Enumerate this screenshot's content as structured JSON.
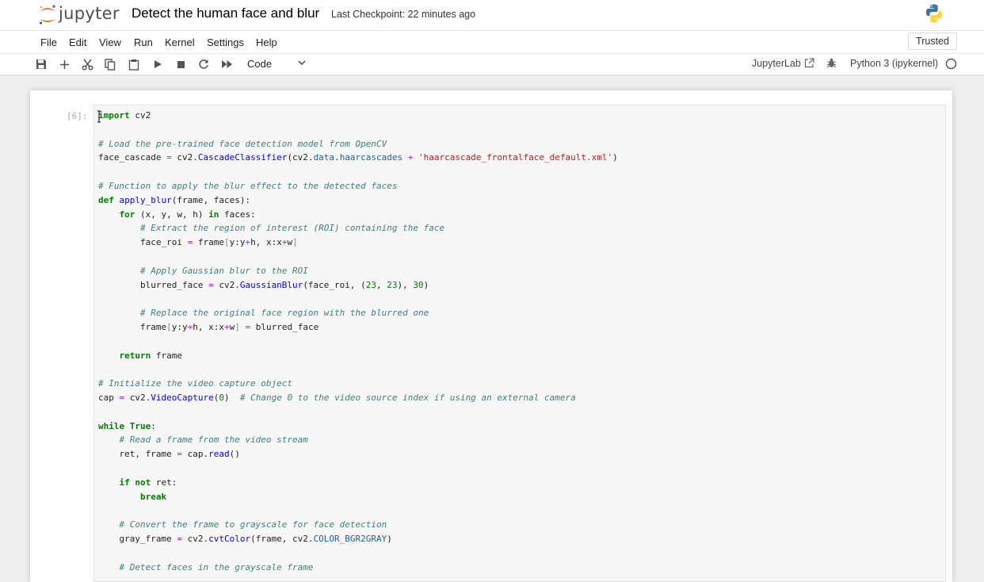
{
  "header": {
    "logo_text": "jupyter",
    "notebook_title": "Detect the human face and blur",
    "checkpoint": "Last Checkpoint: 22 minutes ago"
  },
  "menu": {
    "items": [
      "File",
      "Edit",
      "View",
      "Run",
      "Kernel",
      "Settings",
      "Help"
    ],
    "trusted_label": "Trusted"
  },
  "toolbar": {
    "icons": [
      "save-icon",
      "add-cell-icon",
      "cut-icon",
      "copy-icon",
      "paste-icon",
      "run-icon",
      "stop-icon",
      "restart-icon",
      "fast-forward-icon"
    ],
    "cell_type": "Code",
    "jupyterlab_label": "JupyterLab",
    "kernel_name": "Python 3 (ipykernel)"
  },
  "cell": {
    "prompt": "[6]:",
    "lines": [
      [
        {
          "t": "import",
          "c": "kw"
        },
        {
          "t": " cv2"
        }
      ],
      [],
      [
        {
          "t": "# Load the pre-trained face detection model from OpenCV",
          "c": "cm"
        }
      ],
      [
        {
          "t": "face_cascade "
        },
        {
          "t": "=",
          "c": "op"
        },
        {
          "t": " cv2."
        },
        {
          "t": "CascadeClassifier",
          "c": "fn"
        },
        {
          "t": "(cv2."
        },
        {
          "t": "data",
          "c": "at"
        },
        {
          "t": "."
        },
        {
          "t": "haarcascades",
          "c": "at"
        },
        {
          "t": " "
        },
        {
          "t": "+",
          "c": "op"
        },
        {
          "t": " "
        },
        {
          "t": "'haarcascade_frontalface_default.xml'",
          "c": "st"
        },
        {
          "t": ")"
        }
      ],
      [],
      [
        {
          "t": "# Function to apply the blur effect to the detected faces",
          "c": "cm"
        }
      ],
      [
        {
          "t": "def",
          "c": "kw"
        },
        {
          "t": " "
        },
        {
          "t": "apply_blur",
          "c": "fn"
        },
        {
          "t": "(frame, faces):"
        }
      ],
      [
        {
          "t": "    "
        },
        {
          "t": "for",
          "c": "kw"
        },
        {
          "t": " (x, y, w, h) "
        },
        {
          "t": "in",
          "c": "kw"
        },
        {
          "t": " faces:"
        }
      ],
      [
        {
          "t": "        "
        },
        {
          "t": "# Extract the region of interest (ROI) containing the face",
          "c": "cm"
        }
      ],
      [
        {
          "t": "        face_roi "
        },
        {
          "t": "=",
          "c": "op"
        },
        {
          "t": " frame"
        },
        {
          "t": "[",
          "c": "br"
        },
        {
          "t": "y:y"
        },
        {
          "t": "+",
          "c": "op"
        },
        {
          "t": "h, x:x"
        },
        {
          "t": "+",
          "c": "op"
        },
        {
          "t": "w"
        },
        {
          "t": "]",
          "c": "br"
        }
      ],
      [],
      [
        {
          "t": "        "
        },
        {
          "t": "# Apply Gaussian blur to the ROI",
          "c": "cm"
        }
      ],
      [
        {
          "t": "        blurred_face "
        },
        {
          "t": "=",
          "c": "op"
        },
        {
          "t": " cv2."
        },
        {
          "t": "GaussianBlur",
          "c": "fn"
        },
        {
          "t": "(face_roi, ("
        },
        {
          "t": "23",
          "c": "nu"
        },
        {
          "t": ", "
        },
        {
          "t": "23",
          "c": "nu"
        },
        {
          "t": "), "
        },
        {
          "t": "30",
          "c": "nu"
        },
        {
          "t": ")"
        }
      ],
      [],
      [
        {
          "t": "        "
        },
        {
          "t": "# Replace the original face region with the blurred one",
          "c": "cm"
        }
      ],
      [
        {
          "t": "        frame"
        },
        {
          "t": "[",
          "c": "br"
        },
        {
          "t": "y:y"
        },
        {
          "t": "+",
          "c": "op"
        },
        {
          "t": "h, x:x"
        },
        {
          "t": "+",
          "c": "op"
        },
        {
          "t": "w"
        },
        {
          "t": "]",
          "c": "br"
        },
        {
          "t": " "
        },
        {
          "t": "=",
          "c": "op"
        },
        {
          "t": " blurred_face"
        }
      ],
      [],
      [
        {
          "t": "    "
        },
        {
          "t": "return",
          "c": "kw"
        },
        {
          "t": " frame"
        }
      ],
      [],
      [
        {
          "t": "# Initialize the video capture object",
          "c": "cm"
        }
      ],
      [
        {
          "t": "cap "
        },
        {
          "t": "=",
          "c": "op"
        },
        {
          "t": " cv2."
        },
        {
          "t": "VideoCapture",
          "c": "fn"
        },
        {
          "t": "("
        },
        {
          "t": "0",
          "c": "nu"
        },
        {
          "t": ")  "
        },
        {
          "t": "# Change 0 to the video source index if using an external camera",
          "c": "cm"
        }
      ],
      [],
      [
        {
          "t": "while",
          "c": "kw"
        },
        {
          "t": " "
        },
        {
          "t": "True",
          "c": "kw"
        },
        {
          "t": ":"
        }
      ],
      [
        {
          "t": "    "
        },
        {
          "t": "# Read a frame from the video stream",
          "c": "cm"
        }
      ],
      [
        {
          "t": "    ret, frame "
        },
        {
          "t": "=",
          "c": "op"
        },
        {
          "t": " cap."
        },
        {
          "t": "read",
          "c": "fn"
        },
        {
          "t": "()"
        }
      ],
      [],
      [
        {
          "t": "    "
        },
        {
          "t": "if",
          "c": "kw"
        },
        {
          "t": " "
        },
        {
          "t": "not",
          "c": "kw"
        },
        {
          "t": " ret:"
        }
      ],
      [
        {
          "t": "        "
        },
        {
          "t": "break",
          "c": "kw"
        }
      ],
      [],
      [
        {
          "t": "    "
        },
        {
          "t": "# Convert the frame to grayscale for face detection",
          "c": "cm"
        }
      ],
      [
        {
          "t": "    gray_frame "
        },
        {
          "t": "=",
          "c": "op"
        },
        {
          "t": " cv2."
        },
        {
          "t": "cvtColor",
          "c": "fn"
        },
        {
          "t": "(frame, cv2."
        },
        {
          "t": "COLOR_BGR2GRAY",
          "c": "at"
        },
        {
          "t": ")"
        }
      ],
      [],
      [
        {
          "t": "    "
        },
        {
          "t": "# Detect faces in the grayscale frame",
          "c": "cm"
        }
      ]
    ]
  },
  "colors": {
    "jupyter_orange": "#f37626",
    "python_blue": "#3a75a9",
    "python_yellow": "#ffd43b"
  }
}
